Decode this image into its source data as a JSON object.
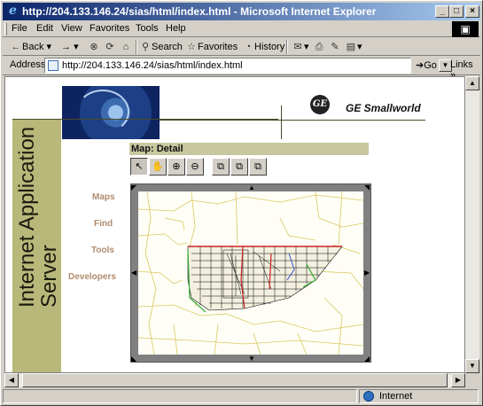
{
  "window": {
    "title": "http://204.133.146.24/sias/html/index.html - Microsoft Internet Explorer",
    "btn_min": "_",
    "btn_max": "□",
    "btn_close": "×"
  },
  "menubar": {
    "items": [
      "File",
      "Edit",
      "View",
      "Favorites",
      "Tools",
      "Help"
    ]
  },
  "toolbar": {
    "back": "Back",
    "forward": "→",
    "search": "Search",
    "favorites": "Favorites",
    "history": "History"
  },
  "address": {
    "label": "Address",
    "url": "http://204.133.146.24/sias/html/index.html",
    "go": "Go",
    "links": "Links"
  },
  "page": {
    "vertical_title": "Internet Application Server",
    "brand": "GE Smallworld",
    "ge_mark": "GE",
    "nav": [
      "Maps",
      "Find",
      "Tools",
      "Developers"
    ],
    "map_heading": "Map: Detail",
    "map_tools": [
      "select",
      "pan",
      "zoom-in",
      "zoom-out",
      "extent-1",
      "extent-2",
      "extent-3"
    ]
  },
  "status": {
    "zone": "Internet"
  },
  "colors": {
    "titlebar": "#0a246a",
    "sidebar": "#b8b87a",
    "nav_link": "#b08c6e",
    "map_road_red": "#cc2222",
    "map_parcel": "#d8c860",
    "map_green": "#33aa33"
  }
}
